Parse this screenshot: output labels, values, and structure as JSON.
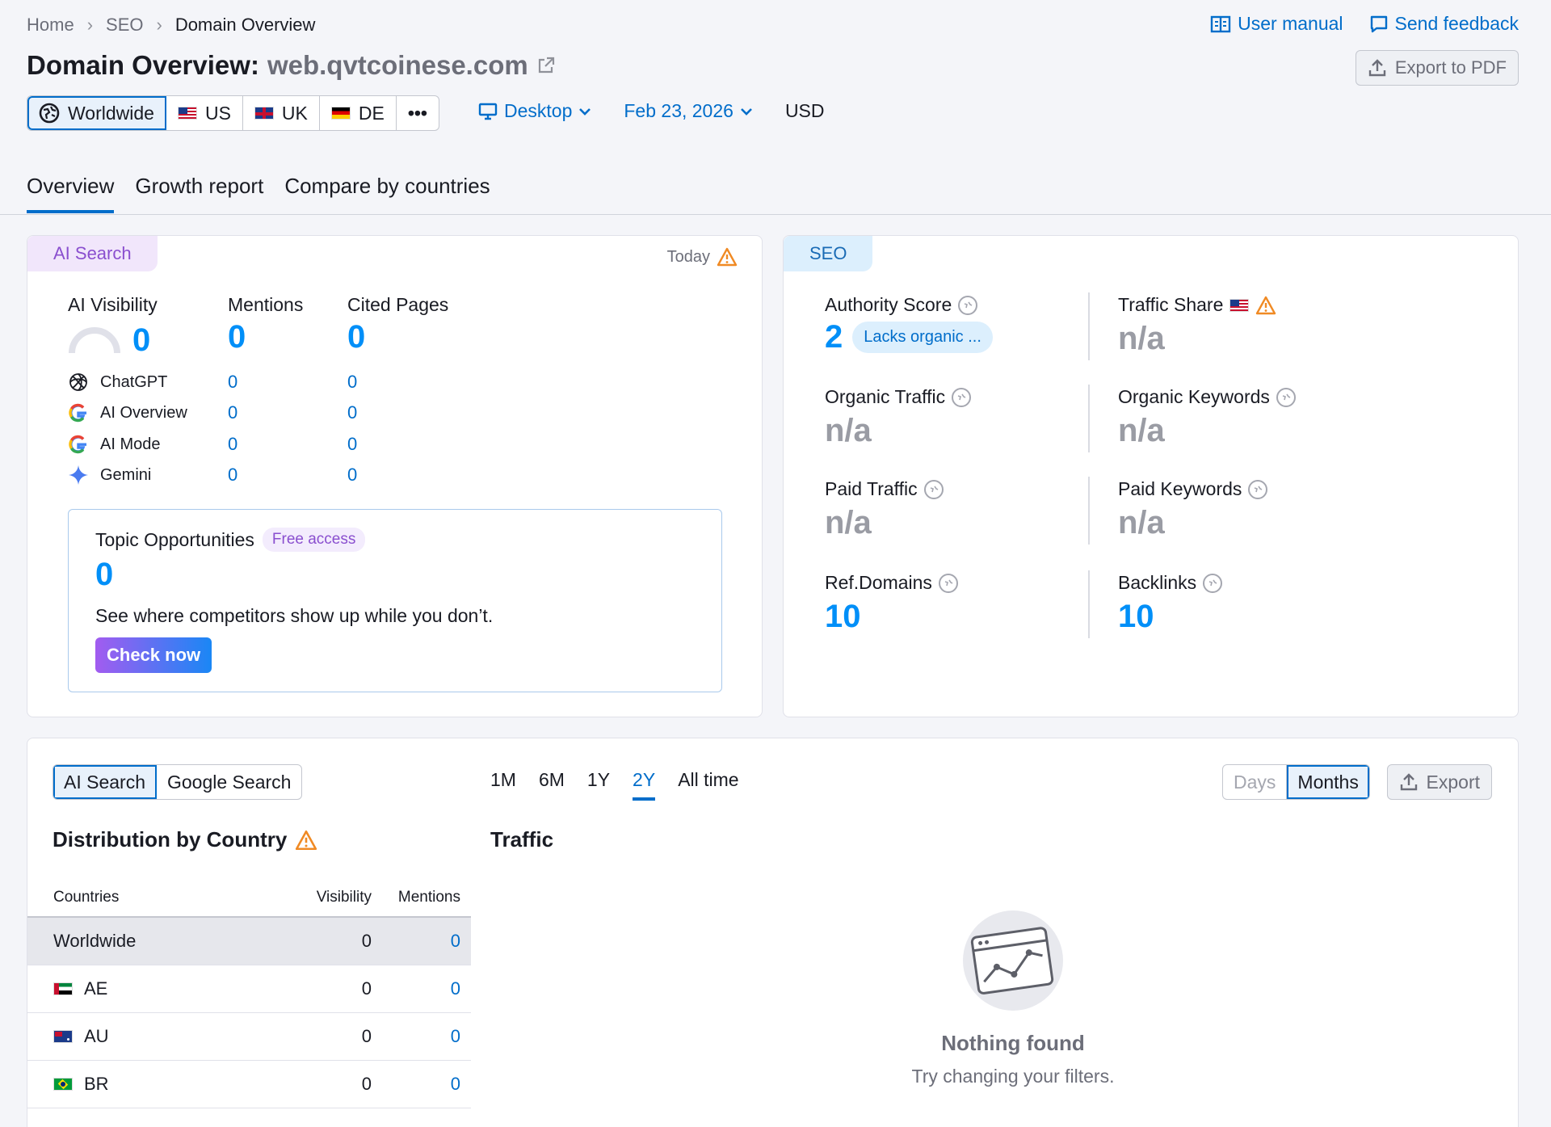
{
  "breadcrumb": [
    "Home",
    "SEO",
    "Domain Overview"
  ],
  "top_links": {
    "manual": "User manual",
    "feedback": "Send feedback"
  },
  "title": {
    "label": "Domain Overview:",
    "domain": "web.qvtcoinese.com"
  },
  "export_pdf": "Export to PDF",
  "databases": [
    {
      "label": "Worldwide",
      "icon": "globe-icon"
    },
    {
      "label": "US",
      "icon": "flag-us"
    },
    {
      "label": "UK",
      "icon": "flag-uk"
    },
    {
      "label": "DE",
      "icon": "flag-de"
    }
  ],
  "more": "•••",
  "device": "Desktop",
  "date": "Feb 23, 2026",
  "currency": "USD",
  "tabs": [
    "Overview",
    "Growth report",
    "Compare by countries"
  ],
  "ai_card": {
    "tag": "AI Search",
    "today": "Today",
    "metrics": [
      {
        "label": "AI Visibility",
        "value": "0"
      },
      {
        "label": "Mentions",
        "value": "0"
      },
      {
        "label": "Cited Pages",
        "value": "0"
      }
    ],
    "sources": [
      {
        "name": "ChatGPT",
        "mentions": "0",
        "cited": "0",
        "icon": "chatgpt-icon"
      },
      {
        "name": "AI Overview",
        "mentions": "0",
        "cited": "0",
        "icon": "google-icon"
      },
      {
        "name": "AI Mode",
        "mentions": "0",
        "cited": "0",
        "icon": "google-icon"
      },
      {
        "name": "Gemini",
        "mentions": "0",
        "cited": "0",
        "icon": "gemini-icon"
      }
    ],
    "topic": {
      "title": "Topic Opportunities",
      "badge": "Free access",
      "value": "0",
      "text": "See where competitors show up while you don’t.",
      "button": "Check now"
    }
  },
  "seo_card": {
    "tag": "SEO",
    "authority": {
      "label": "Authority Score",
      "value": "2",
      "badge": "Lacks organic ..."
    },
    "traffic_share": {
      "label": "Traffic Share",
      "value": "n/a"
    },
    "organic_traffic": {
      "label": "Organic Traffic",
      "value": "n/a"
    },
    "organic_keywords": {
      "label": "Organic Keywords",
      "value": "n/a"
    },
    "paid_traffic": {
      "label": "Paid Traffic",
      "value": "n/a"
    },
    "paid_keywords": {
      "label": "Paid Keywords",
      "value": "n/a"
    },
    "ref_domains": {
      "label": "Ref.Domains",
      "value": "10"
    },
    "backlinks": {
      "label": "Backlinks",
      "value": "10"
    }
  },
  "bottom": {
    "source_toggle": [
      "AI Search",
      "Google Search"
    ],
    "periods": [
      "1M",
      "6M",
      "1Y",
      "2Y",
      "All time"
    ],
    "granularity": [
      "Days",
      "Months"
    ],
    "export": "Export",
    "distribution_title": "Distribution by Country",
    "traffic_title": "Traffic",
    "table": {
      "headers": [
        "Countries",
        "Visibility",
        "Mentions"
      ],
      "rows": [
        {
          "country": "Worldwide",
          "visibility": "0",
          "mentions": "0"
        },
        {
          "country": "AE",
          "visibility": "0",
          "mentions": "0"
        },
        {
          "country": "AU",
          "visibility": "0",
          "mentions": "0"
        },
        {
          "country": "BR",
          "visibility": "0",
          "mentions": "0"
        }
      ]
    },
    "empty": {
      "title": "Nothing found",
      "subtitle": "Try changing your filters."
    }
  },
  "colors": {
    "accent": "#006dca",
    "metric_blue": "#008ff8",
    "warning": "#f08a24"
  }
}
